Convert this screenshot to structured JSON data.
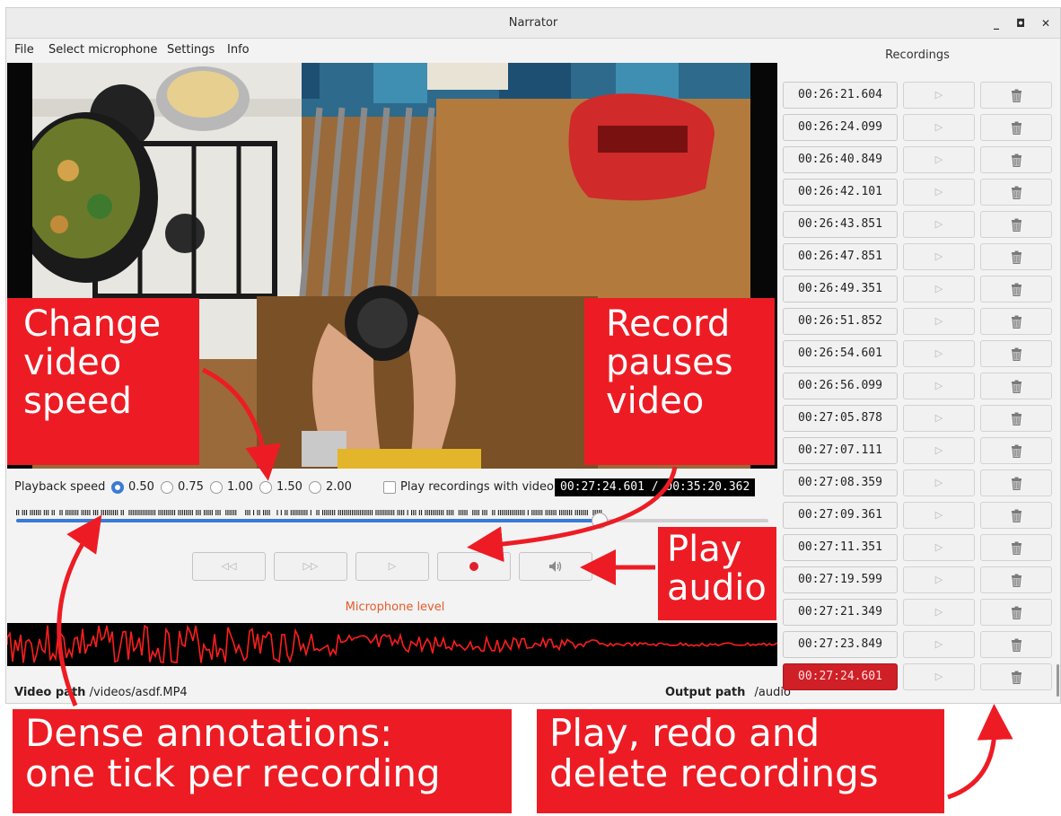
{
  "window": {
    "title": "Narrator",
    "minimize": "_",
    "maximize": "◘",
    "close": "✕"
  },
  "menu": [
    "File",
    "Select microphone",
    "Settings",
    "Info"
  ],
  "playback": {
    "label": "Playback speed",
    "options": [
      "0.50",
      "0.75",
      "1.00",
      "1.50",
      "2.00"
    ],
    "selected": "0.50",
    "play_with_video_label": "Play recordings with video",
    "play_with_video_checked": false,
    "current_time": "00:27:24.601",
    "total_time": "00:35:20.362",
    "timecode_text": "00:27:24.601 / 00:35:20.362",
    "progress_fraction": 0.776
  },
  "controls": {
    "rewind": "rewind-icon",
    "fast_forward": "fast-forward-icon",
    "play": "play-icon",
    "record": "record-icon",
    "play_audio": "speaker-icon"
  },
  "microphone_level_label": "Microphone level",
  "video_path": {
    "label": "Video path",
    "value": "/videos/asdf.MP4"
  },
  "output_path": {
    "label": "Output path",
    "value": "/audio"
  },
  "recordings": {
    "title": "Recordings",
    "items": [
      "00:26:21.604",
      "00:26:24.099",
      "00:26:40.849",
      "00:26:42.101",
      "00:26:43.851",
      "00:26:47.851",
      "00:26:49.351",
      "00:26:51.852",
      "00:26:54.601",
      "00:26:56.099",
      "00:27:05.878",
      "00:27:07.111",
      "00:27:08.359",
      "00:27:09.361",
      "00:27:11.351",
      "00:27:19.599",
      "00:27:21.349",
      "00:27:23.849",
      "00:27:24.601"
    ],
    "active_index": 18
  },
  "annotations": {
    "speed": "Change\nvideo\nspeed",
    "record": "Record\npauses\nvideo",
    "audio": "Play\naudio",
    "dense": "Dense annotations:\none tick per recording",
    "manage": "Play, redo and\ndelete recordings"
  },
  "colors": {
    "accent": "#3a7bd5",
    "annotation": "#ed1c24",
    "active_recording": "#cf1f27",
    "mic_label": "#e85a2a"
  }
}
